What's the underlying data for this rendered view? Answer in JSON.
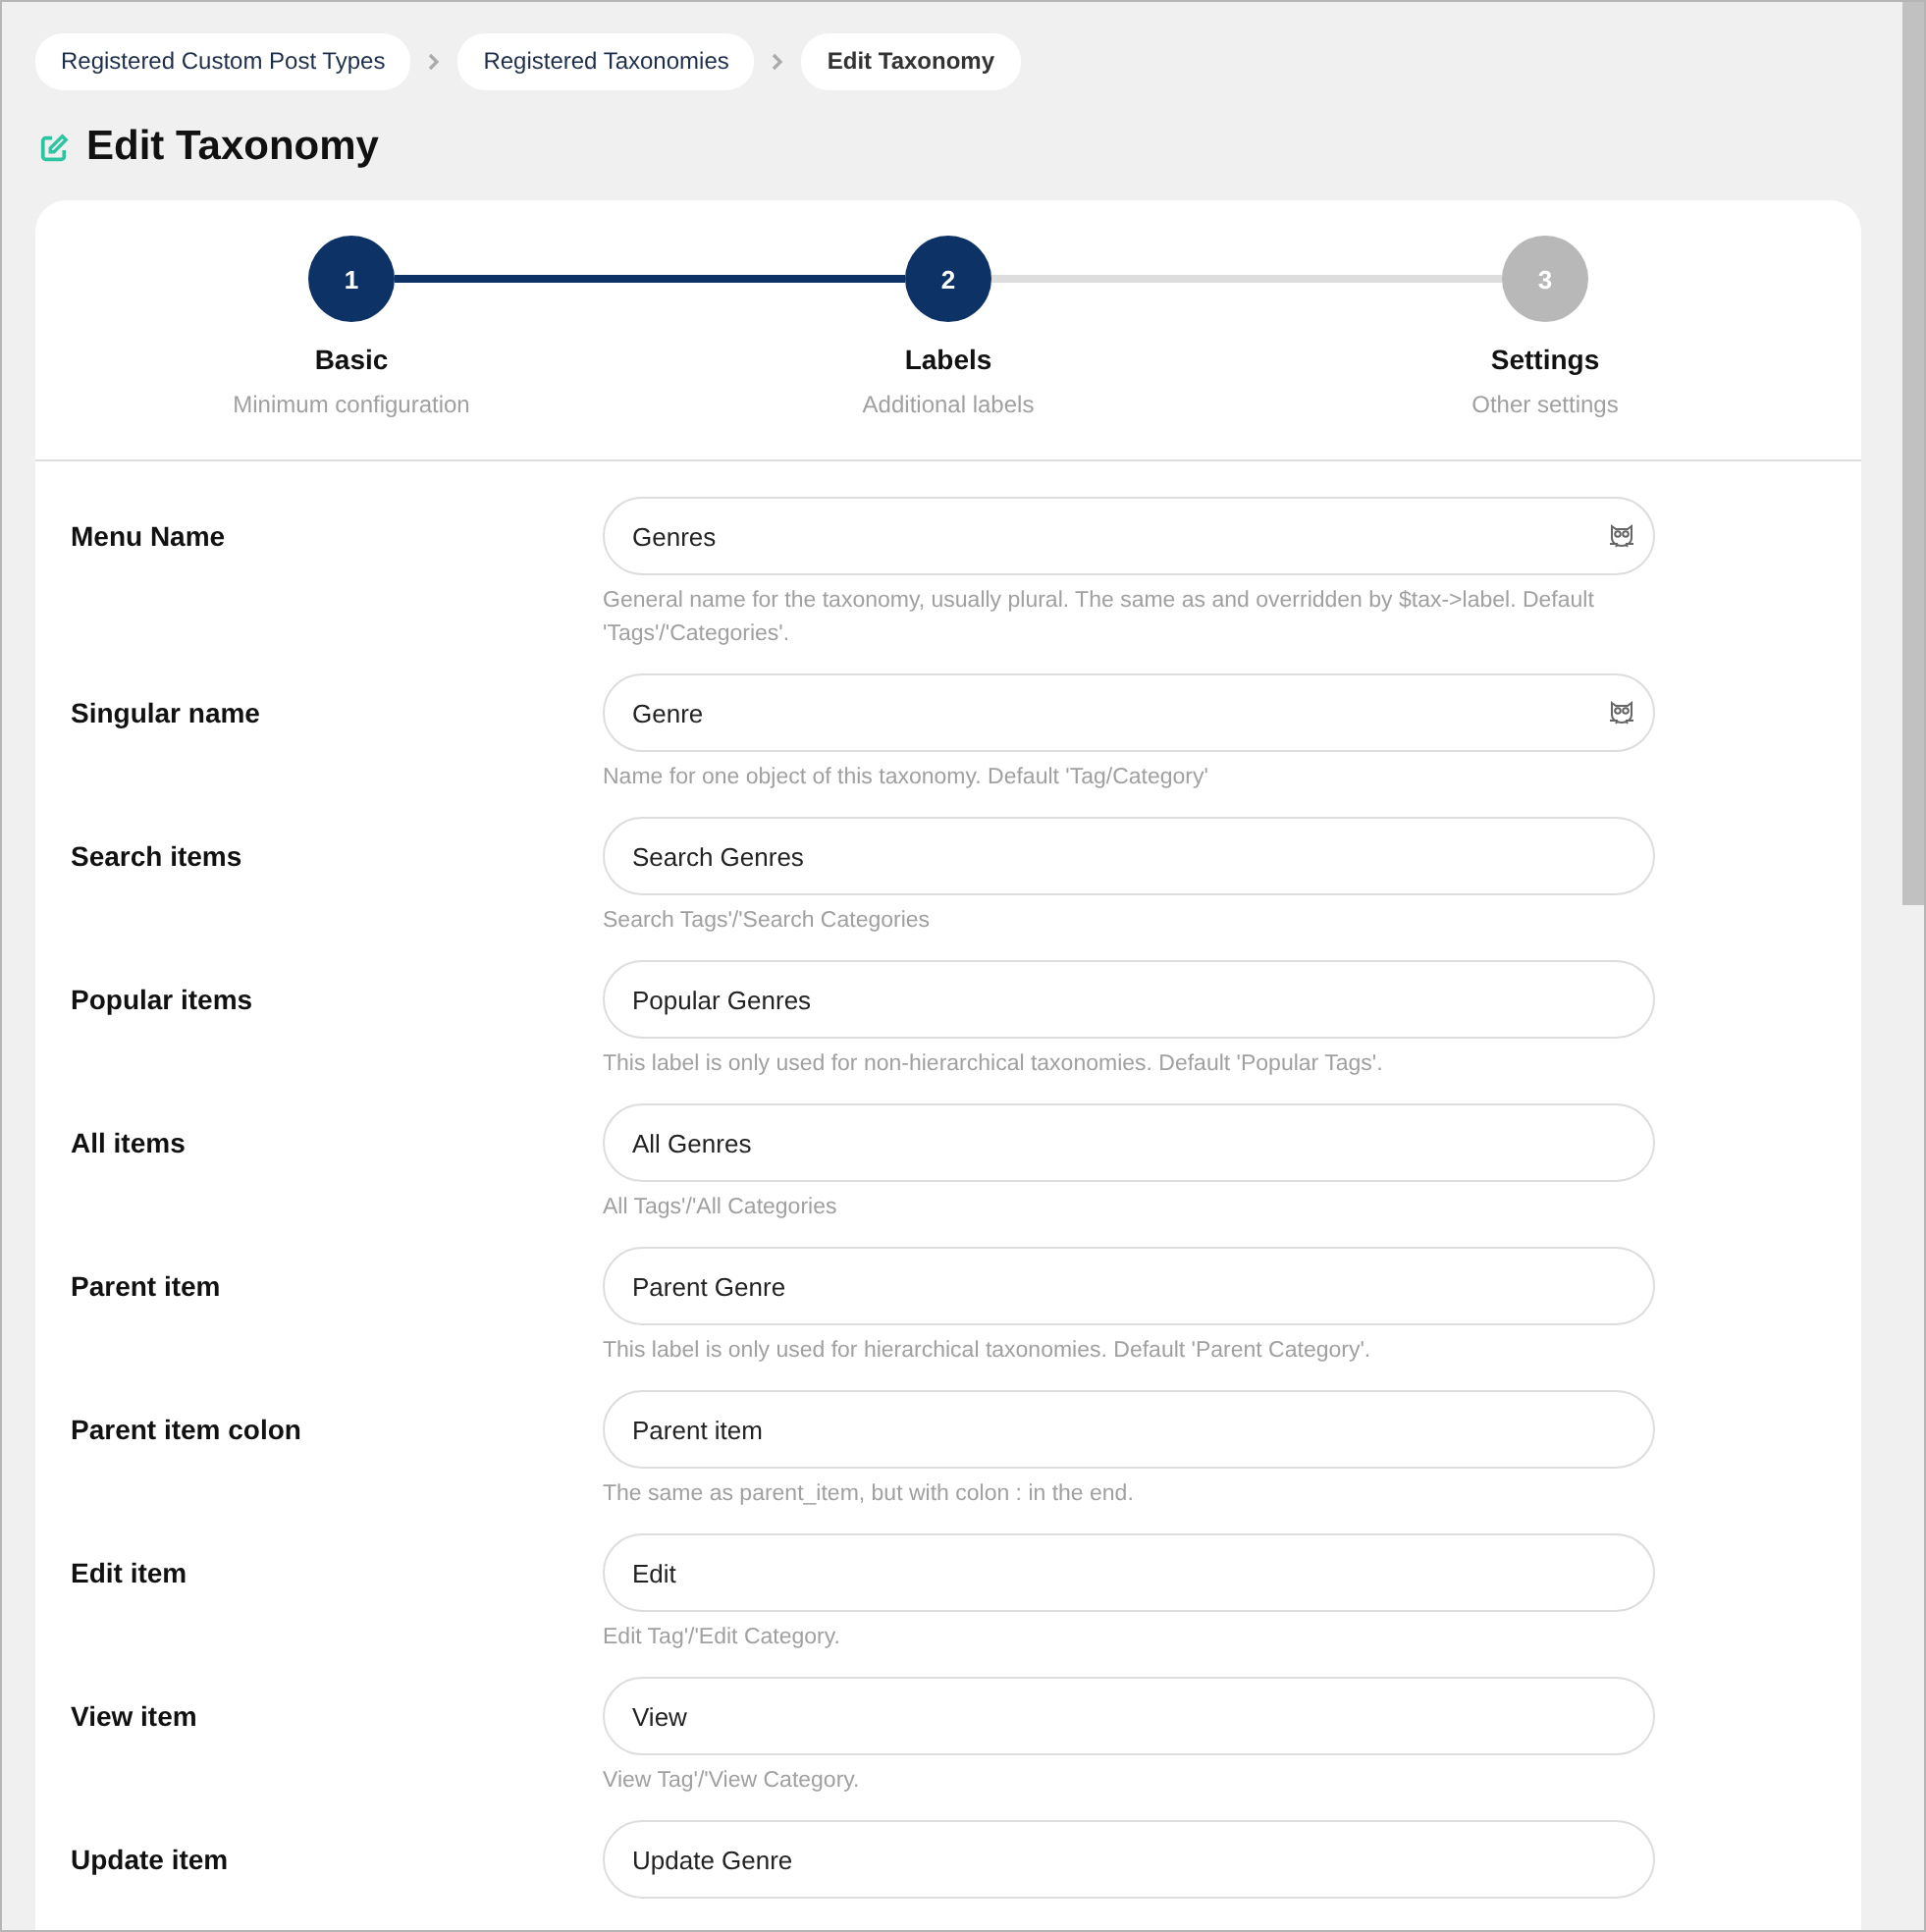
{
  "breadcrumbs": [
    {
      "label": "Registered Custom Post Types",
      "current": false
    },
    {
      "label": "Registered Taxonomies",
      "current": false
    },
    {
      "label": "Edit Taxonomy",
      "current": true
    }
  ],
  "title": "Edit Taxonomy",
  "steps": [
    {
      "number": "1",
      "title": "Basic",
      "subtitle": "Minimum configuration",
      "active": true
    },
    {
      "number": "2",
      "title": "Labels",
      "subtitle": "Additional labels",
      "active": true
    },
    {
      "number": "3",
      "title": "Settings",
      "subtitle": "Other settings",
      "active": false
    }
  ],
  "fields": [
    {
      "label": "Menu Name",
      "value": "Genres",
      "hint": "General name for the taxonomy, usually plural. The same as and overridden by $tax->label. Default 'Tags'/'Categories'.",
      "icon": true
    },
    {
      "label": "Singular name",
      "value": "Genre",
      "hint": "Name for one object of this taxonomy. Default 'Tag/Category'",
      "icon": true
    },
    {
      "label": "Search items",
      "value": "Search Genres",
      "hint": "Search Tags'/'Search Categories",
      "icon": false
    },
    {
      "label": "Popular items",
      "value": "Popular Genres",
      "hint": "This label is only used for non-hierarchical taxonomies. Default 'Popular Tags'.",
      "icon": false
    },
    {
      "label": "All items",
      "value": "All Genres",
      "hint": "All Tags'/'All Categories",
      "icon": false
    },
    {
      "label": "Parent item",
      "value": "Parent Genre",
      "hint": "This label is only used for hierarchical taxonomies. Default 'Parent Category'.",
      "icon": false
    },
    {
      "label": "Parent item colon",
      "value": "Parent item",
      "hint": "The same as parent_item, but with colon : in the end.",
      "icon": false
    },
    {
      "label": "Edit item",
      "value": "Edit",
      "hint": "Edit Tag'/'Edit Category.",
      "icon": false
    },
    {
      "label": "View item",
      "value": "View",
      "hint": "View Tag'/'View Category.",
      "icon": false
    },
    {
      "label": "Update item",
      "value": "Update Genre",
      "icon": false
    }
  ]
}
